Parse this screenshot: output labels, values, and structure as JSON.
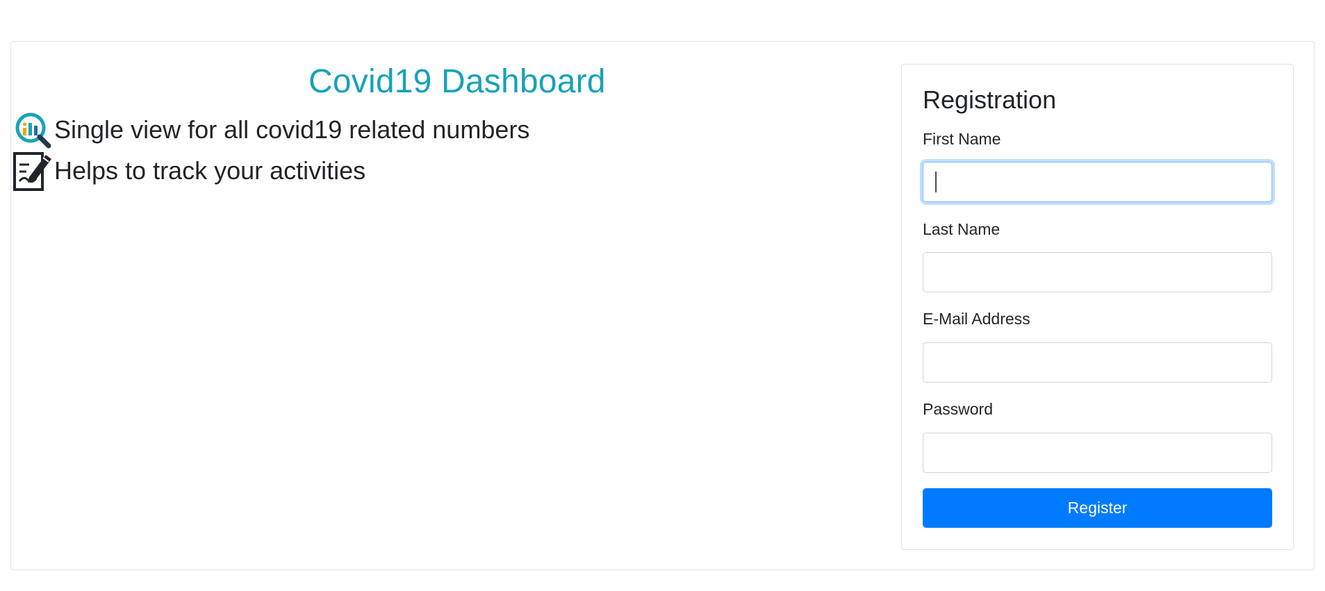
{
  "hero": {
    "title": "Covid19 Dashboard",
    "features": [
      {
        "icon": "analytics-search-icon",
        "text": "Single view for all covid19 related numbers"
      },
      {
        "icon": "document-edit-icon",
        "text": "Helps to track your activities"
      }
    ]
  },
  "registration": {
    "title": "Registration",
    "fields": [
      {
        "label": "First Name",
        "value": "",
        "placeholder": "",
        "focused": true
      },
      {
        "label": "Last Name",
        "value": "",
        "placeholder": ""
      },
      {
        "label": "E-Mail Address",
        "value": "",
        "placeholder": ""
      },
      {
        "label": "Password",
        "value": "",
        "placeholder": ""
      }
    ],
    "submit_label": "Register"
  },
  "colors": {
    "title": "#17a2b8",
    "primary": "#007bff",
    "focus_border": "#80bdff"
  }
}
